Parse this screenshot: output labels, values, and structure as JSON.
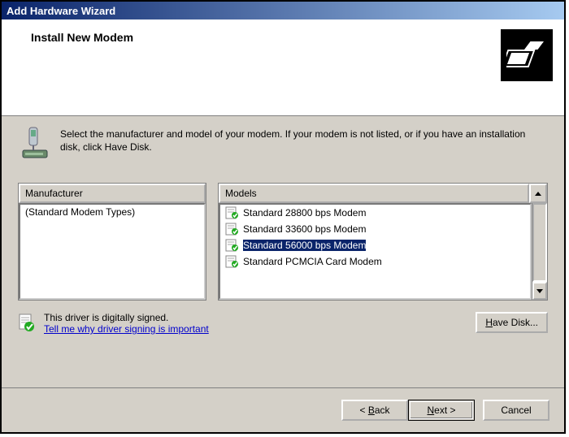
{
  "window": {
    "title": "Add Hardware Wizard"
  },
  "header": {
    "title": "Install New Modem"
  },
  "instruction": "Select the manufacturer and model of your modem. If your modem is not listed, or if you have an installation disk, click Have Disk.",
  "manufacturer": {
    "header": "Manufacturer",
    "items": [
      "(Standard Modem Types)"
    ]
  },
  "models": {
    "header": "Models",
    "items": [
      "Standard 28800 bps Modem",
      "Standard 33600 bps Modem",
      "Standard 56000 bps Modem",
      "Standard PCMCIA Card Modem"
    ],
    "selected_index": 2
  },
  "signing": {
    "status": "This driver is digitally signed.",
    "link": "Tell me why driver signing is important"
  },
  "buttons": {
    "have_disk": "Have Disk...",
    "back": "< Back",
    "next": "Next >",
    "cancel": "Cancel",
    "back_u": "B",
    "next_u": "N",
    "have_disk_u": "H"
  }
}
